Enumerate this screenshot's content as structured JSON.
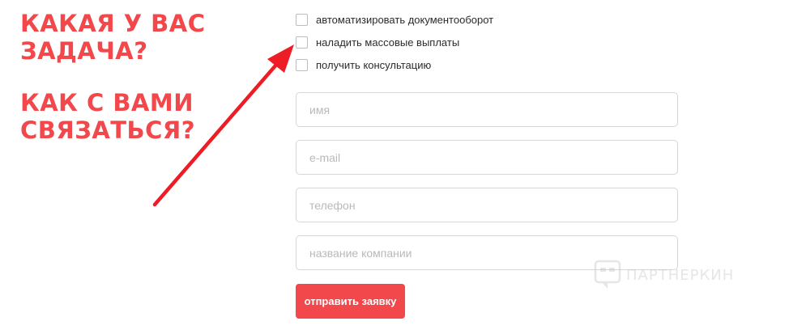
{
  "headings": {
    "task_line1": "КАКАЯ У ВАС",
    "task_line2": "ЗАДАЧА?",
    "contact_line1": "КАК С ВАМИ",
    "contact_line2": "СВЯЗАТЬСЯ?"
  },
  "options": [
    {
      "label": "автоматизировать документооборот",
      "checked": false
    },
    {
      "label": "наладить массовые выплаты",
      "checked": false
    },
    {
      "label": "получить консультацию",
      "checked": false
    }
  ],
  "fields": {
    "name_placeholder": "имя",
    "email_placeholder": "e-mail",
    "phone_placeholder": "телефон",
    "company_placeholder": "название компании"
  },
  "submit_label": "отправить заявку",
  "watermark": "ПАРТНЕРКИН",
  "colors": {
    "accent": "#f2474b",
    "arrow": "#ee1c24",
    "field_border": "#d6d6d6",
    "placeholder": "#b9b9b9"
  },
  "icons": {
    "arrow": "red-arrow-icon",
    "watermark_logo": "partnerkin-logo-icon"
  }
}
